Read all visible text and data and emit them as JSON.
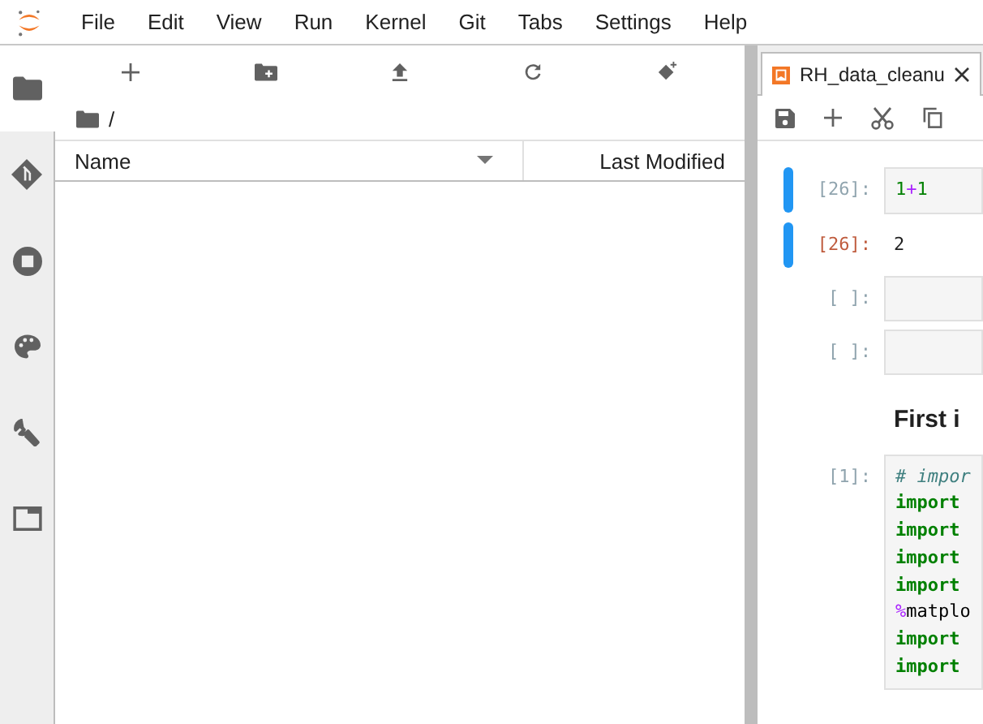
{
  "menu": [
    "File",
    "Edit",
    "View",
    "Run",
    "Kernel",
    "Git",
    "Tabs",
    "Settings",
    "Help"
  ],
  "sidebar": {
    "items": [
      {
        "kind": "files",
        "selected": true
      },
      {
        "kind": "git",
        "selected": false
      },
      {
        "kind": "running",
        "selected": false
      },
      {
        "kind": "palette",
        "selected": false
      },
      {
        "kind": "wrench",
        "selected": false
      },
      {
        "kind": "tabs",
        "selected": false
      }
    ]
  },
  "file_browser": {
    "breadcrumb": "/",
    "columns": [
      "Name",
      "Last Modified"
    ]
  },
  "notebook": {
    "tab": {
      "title": "RH_data_cleanu"
    },
    "cells": [
      {
        "kind": "code",
        "prompt": "[26]:",
        "selected": true,
        "lines": [
          [
            {
              "text": "1",
              "kind": "number"
            },
            {
              "text": "+",
              "kind": "operator"
            },
            {
              "text": "1",
              "kind": "number"
            }
          ]
        ],
        "output": {
          "prompt": "[26]:",
          "text": "2"
        }
      },
      {
        "kind": "code",
        "prompt": "[ ]:",
        "selected": false
      },
      {
        "kind": "code",
        "prompt": "[ ]:",
        "selected": false
      },
      {
        "kind": "markdown",
        "text": "First i",
        "selected": false
      },
      {
        "kind": "code",
        "prompt": "[1]:",
        "selected": false,
        "lines": [
          [
            {
              "text": "# impor",
              "kind": "comment"
            }
          ],
          [
            {
              "text": "import",
              "kind": "keyword"
            }
          ],
          [
            {
              "text": "import",
              "kind": "keyword"
            }
          ],
          [
            {
              "text": "import",
              "kind": "keyword"
            }
          ],
          [
            {
              "text": "import",
              "kind": "keyword"
            }
          ],
          [
            {
              "text": "%",
              "kind": "magic"
            },
            {
              "text": "matplo",
              "kind": "plain"
            }
          ],
          [
            {
              "text": "import",
              "kind": "keyword"
            }
          ],
          [
            {
              "text": "import",
              "kind": "keyword"
            }
          ]
        ]
      }
    ]
  }
}
